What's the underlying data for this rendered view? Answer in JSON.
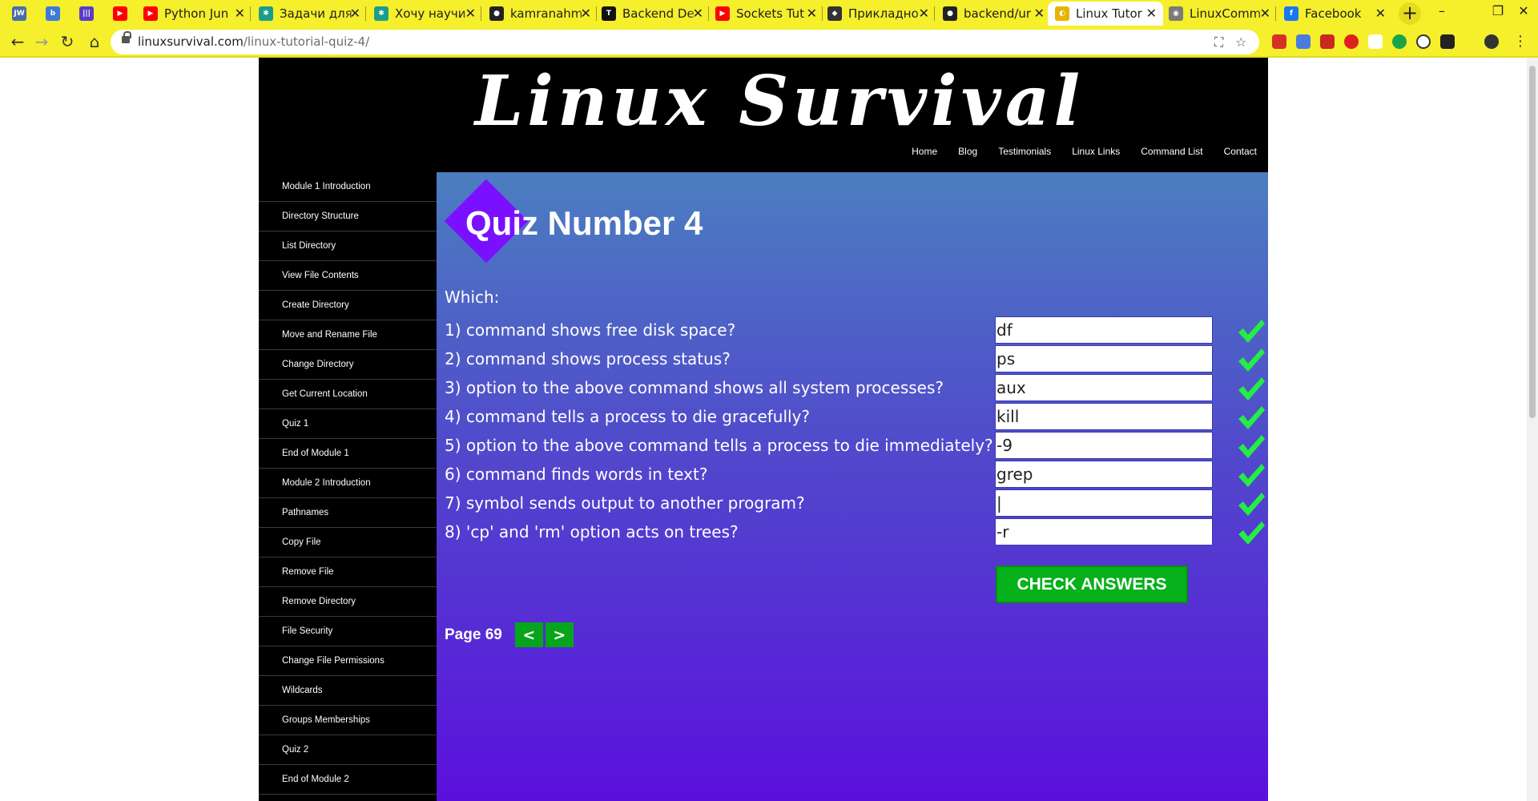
{
  "browser": {
    "tabs": [
      {
        "title": "",
        "fav": "JW",
        "color": "#4a6fa5"
      },
      {
        "title": "",
        "fav": "b",
        "color": "#3d7bd9"
      },
      {
        "title": "",
        "fav": "|||",
        "color": "#5a3cc8"
      },
      {
        "title": "",
        "fav": "▶",
        "color": "#ff0000"
      },
      {
        "title": "Python Jun",
        "fav": "▶",
        "color": "#ff0000"
      },
      {
        "title": "Задачи для",
        "fav": "✱",
        "color": "#1a9e8a"
      },
      {
        "title": "Хочу научи",
        "fav": "✱",
        "color": "#1a9e8a"
      },
      {
        "title": "kamranahm",
        "fav": "●",
        "color": "#222222"
      },
      {
        "title": "Backend De",
        "fav": "T",
        "color": "#111111"
      },
      {
        "title": "Sockets Tut",
        "fav": "▶",
        "color": "#ff0000"
      },
      {
        "title": "Прикладно",
        "fav": "◆",
        "color": "#333333"
      },
      {
        "title": "backend/ur",
        "fav": "●",
        "color": "#222222"
      },
      {
        "title": "Linux Tutor",
        "fav": "◐",
        "color": "#e8b400"
      },
      {
        "title": "LinuxComm",
        "fav": "◉",
        "color": "#7a7a7a"
      },
      {
        "title": "Facebook",
        "fav": "f",
        "color": "#1877f2"
      }
    ],
    "url_host": "linuxsurvival.com",
    "url_path": "/linux-tutorial-quiz-4/"
  },
  "site": {
    "logo": "Linux Survival",
    "nav": [
      "Home",
      "Blog",
      "Testimonials",
      "Linux Links",
      "Command List",
      "Contact"
    ],
    "sidebar": [
      "Module 1 Introduction",
      "Directory Structure",
      "List Directory",
      "View File Contents",
      "Create Directory",
      "Move and Rename File",
      "Change Directory",
      "Get Current Location",
      "Quiz 1",
      "End of Module 1",
      "Module 2 Introduction",
      "Pathnames",
      "Copy File",
      "Remove File",
      "Remove Directory",
      "File Security",
      "Change File Permissions",
      "Wildcards",
      "Groups Memberships",
      "Quiz 2",
      "End of Module 2"
    ]
  },
  "quiz": {
    "title": "Quiz Number 4",
    "intro": "Which:",
    "questions": [
      {
        "text": "1) command shows free disk space?",
        "answer": "df",
        "correct": true
      },
      {
        "text": "2) command shows process status?",
        "answer": "ps",
        "correct": true
      },
      {
        "text": "3) option to the above command shows all system processes?",
        "answer": "aux",
        "correct": true
      },
      {
        "text": "4) command tells a process to die gracefully?",
        "answer": "kill",
        "correct": true
      },
      {
        "text": "5) option to the above command tells a process to die immediately?",
        "answer": "-9",
        "correct": true
      },
      {
        "text": "6) command finds words in text?",
        "answer": "grep",
        "correct": true
      },
      {
        "text": "7) symbol sends output to another program?",
        "answer": "|",
        "correct": true
      },
      {
        "text": "8) 'cp' and 'rm' option acts on trees?",
        "answer": "-r",
        "correct": true
      }
    ],
    "check_button": "CHECK ANSWERS",
    "page_label": "Page 69",
    "prev": "<",
    "next": ">",
    "check_color": "#22ee44"
  }
}
